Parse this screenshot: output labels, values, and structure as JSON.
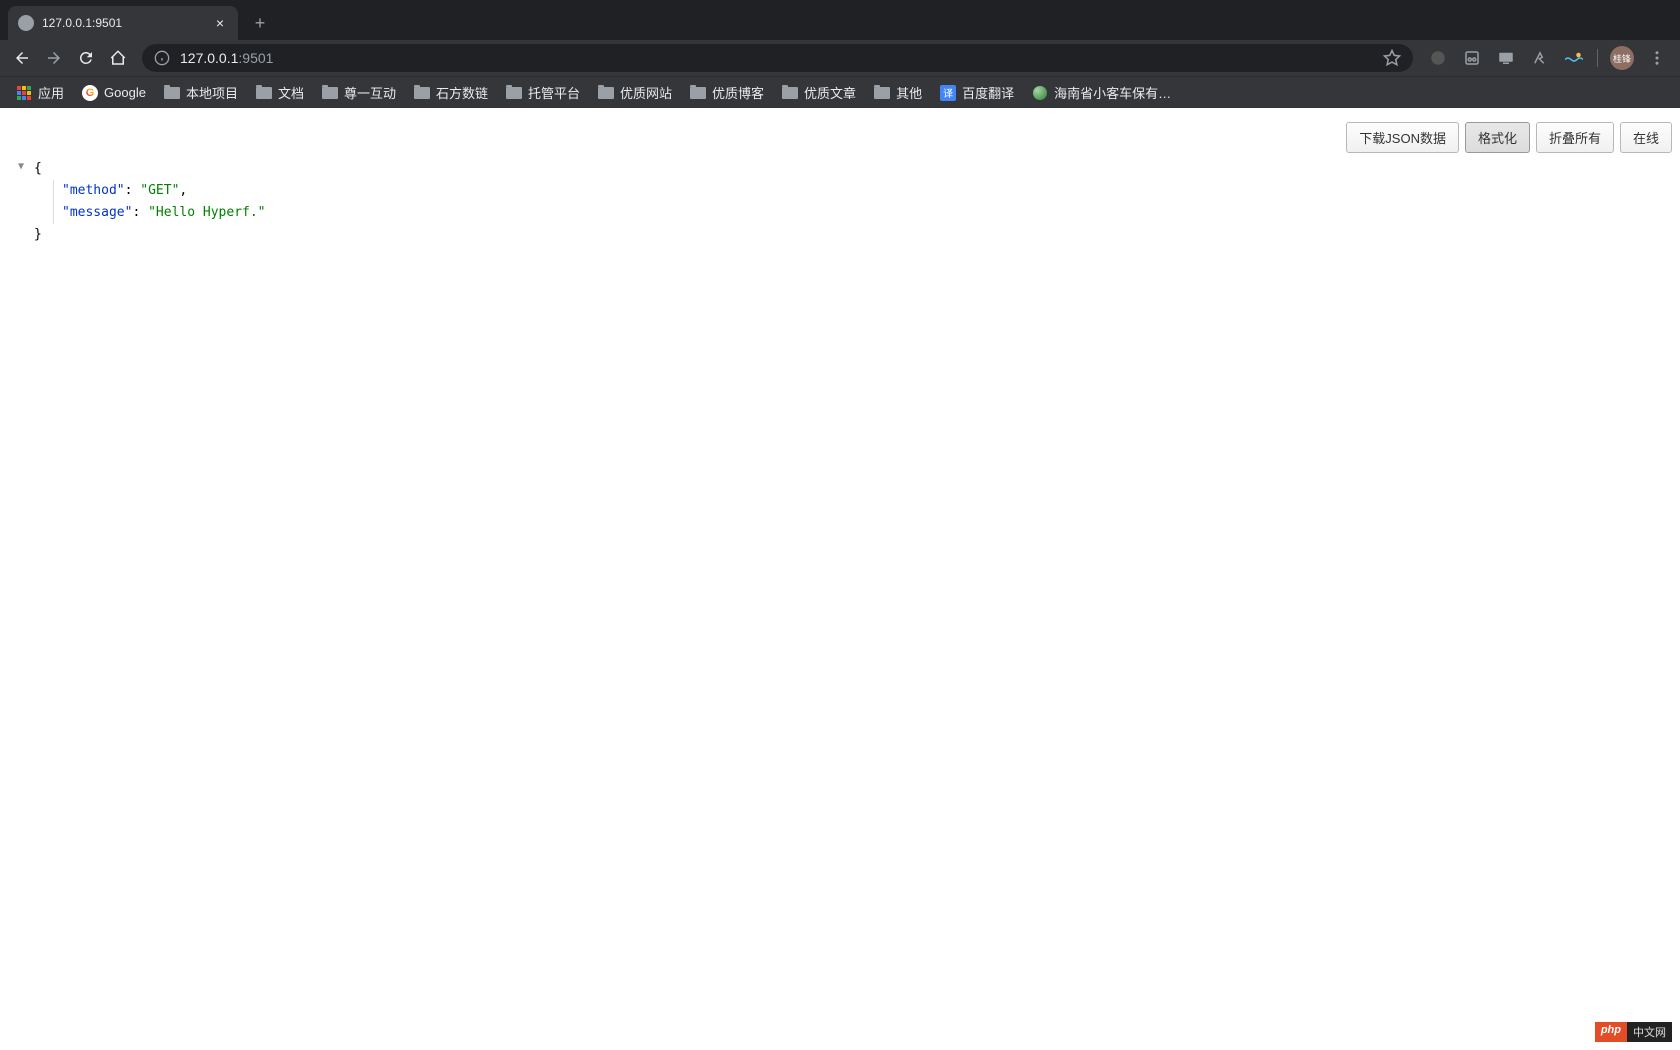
{
  "tab": {
    "title": "127.0.0.1:9501"
  },
  "address": {
    "host": "127.0.0.1",
    "port": ":9501"
  },
  "bookmarks": {
    "apps": "应用",
    "google": "Google",
    "items": [
      "本地项目",
      "文档",
      "尊一互动",
      "石方数链",
      "托管平台",
      "优质网站",
      "优质博客",
      "优质文章",
      "其他"
    ],
    "translate": "百度翻译",
    "translate_icon": "译",
    "hainan": "海南省小客车保有…"
  },
  "json_toolbar": {
    "download": "下载JSON数据",
    "format": "格式化",
    "collapse": "折叠所有",
    "online": "在线"
  },
  "json_body": {
    "k1": "\"method\"",
    "v1": "\"GET\"",
    "k2": "\"message\"",
    "v2": "\"Hello Hyperf.\"",
    "open": "{",
    "close": "}",
    "colon": ": ",
    "comma": ","
  },
  "badge": {
    "left": "php",
    "right": "中文网"
  }
}
